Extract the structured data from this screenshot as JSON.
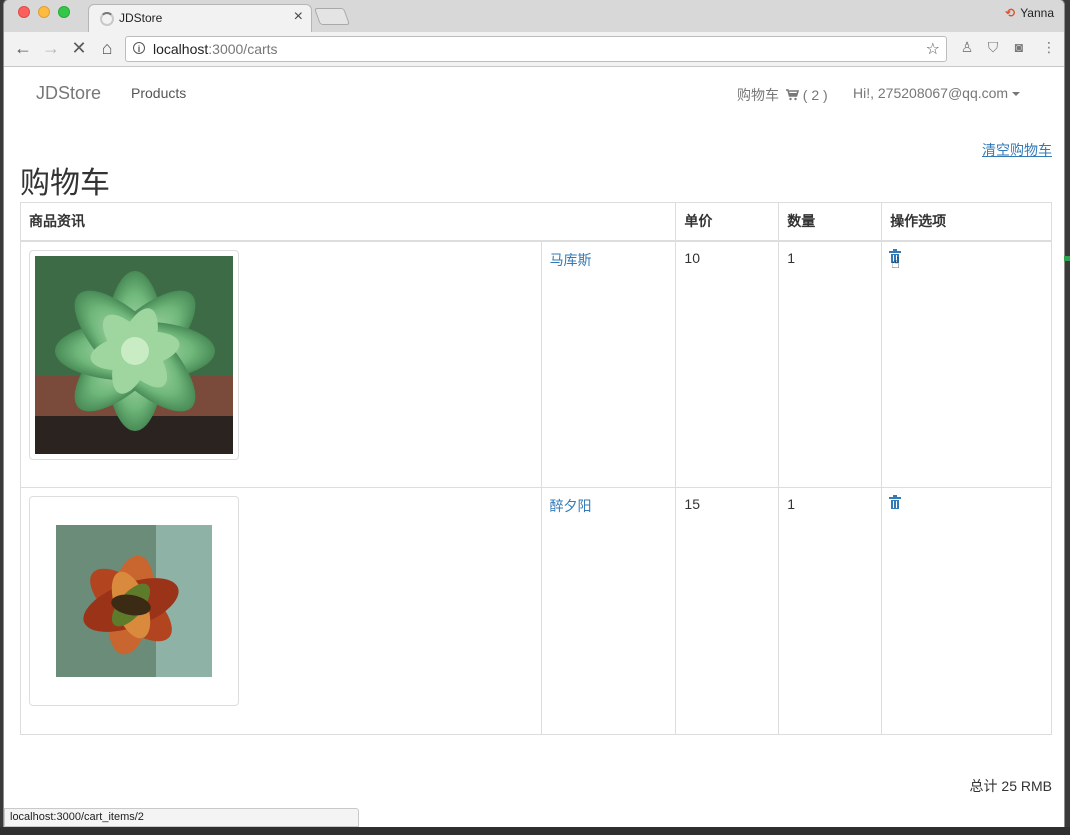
{
  "browser": {
    "tab_title": "JDStore",
    "tab_close": "×",
    "profile_name": "Yanna",
    "url_host": "localhost",
    "url_path": ":3000/carts",
    "status_url": "localhost:3000/cart_items/2"
  },
  "navbar": {
    "brand": "JDStore",
    "products": "Products",
    "cart_label": "购物车",
    "cart_count": "( 2 )",
    "user": "Hi!, 275208067@qq.com"
  },
  "page": {
    "clear_cart": "清空购物车",
    "title": "购物车",
    "table_headers": [
      "商品资讯",
      "单价",
      "数量",
      "操作选项"
    ],
    "items": [
      {
        "name": "马库斯",
        "price": "10",
        "quantity": "1"
      },
      {
        "name": "醉夕阳",
        "price": "15",
        "quantity": "1"
      }
    ],
    "total": "总计 25 RMB"
  },
  "colors": {
    "link": "#337ab7",
    "border": "#dddddd"
  }
}
